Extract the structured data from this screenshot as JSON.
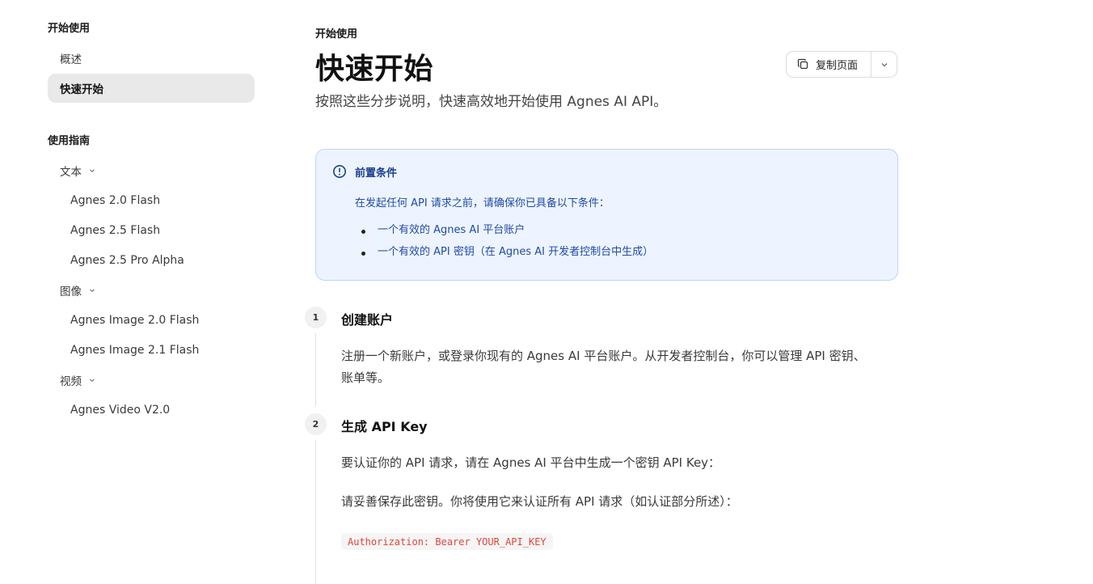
{
  "sidebar": {
    "section1_title": "开始使用",
    "items": [
      {
        "label": "概述"
      },
      {
        "label": "快速开始"
      }
    ],
    "section2_title": "使用指南",
    "groups": [
      {
        "label": "文本",
        "items": [
          "Agnes 2.0 Flash",
          "Agnes 2.5 Flash",
          "Agnes 2.5 Pro Alpha"
        ]
      },
      {
        "label": "图像",
        "items": [
          "Agnes Image 2.0 Flash",
          "Agnes Image 2.1 Flash"
        ]
      },
      {
        "label": "视频",
        "items": [
          "Agnes Video V2.0"
        ]
      }
    ]
  },
  "main": {
    "breadcrumb": "开始使用",
    "title": "快速开始",
    "subtitle": "按照这些分步说明，快速高效地开始使用 Agnes AI API。",
    "copy_button": {
      "label": "复制页面"
    },
    "callout": {
      "title": "前置条件",
      "body": "在发起任何 API 请求之前，请确保你已具备以下条件：",
      "items": [
        "一个有效的 Agnes AI 平台账户",
        "一个有效的 API 密钥（在 Agnes AI 开发者控制台中生成）"
      ]
    },
    "steps": [
      {
        "number": "1",
        "title": "创建账户",
        "text_line1": "注册一个新账户，或登录你现有的 Agnes AI 平台账户。从开发者控制台，你可以管理 API 密钥、",
        "text_line2": "账单等。"
      },
      {
        "number": "2",
        "title": "生成 API Key",
        "text1": "要认证你的 API 请求，请在 Agnes AI 平台中生成一个密钥 API Key：",
        "text2": "请妥善保存此密钥。你将使用它来认证所有 API 请求（如认证部分所述）：",
        "code": "Authorization: Bearer YOUR_API_KEY"
      }
    ]
  },
  "colors": {
    "active_bg": "#e9e9e9",
    "callout_bg": "#edf4ff",
    "callout_border": "#bcd3f5",
    "callout_text": "#1f4aa8",
    "code_text": "#e0463a"
  }
}
